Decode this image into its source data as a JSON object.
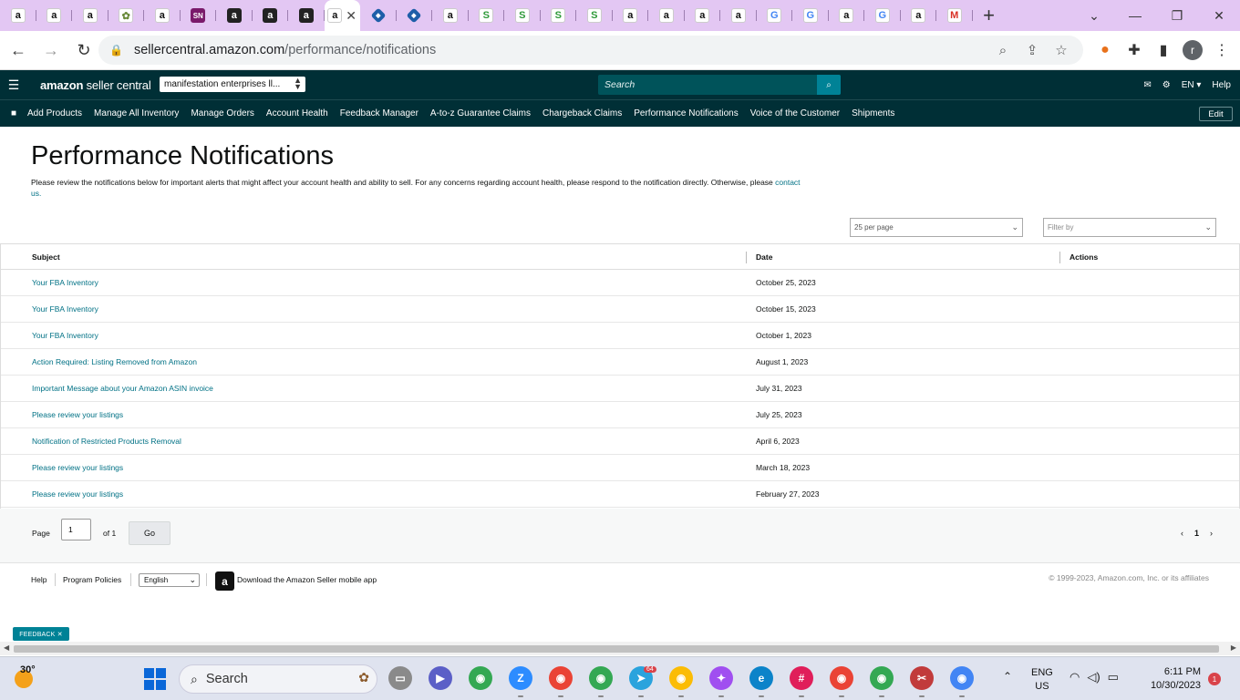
{
  "browser": {
    "tabs": [
      {
        "icon": "amazon-icon",
        "glyph": "a"
      },
      {
        "icon": "amazon-icon",
        "glyph": "a"
      },
      {
        "icon": "amazon-icon",
        "glyph": "a"
      },
      {
        "icon": "plant-icon",
        "glyph": "✿"
      },
      {
        "icon": "amazon-icon",
        "glyph": "a"
      },
      {
        "icon": "sn-icon",
        "glyph": "SN"
      },
      {
        "icon": "amazon-dark-icon",
        "glyph": "a"
      },
      {
        "icon": "amazon-dark-icon",
        "glyph": "a"
      },
      {
        "icon": "amazon-dark-icon",
        "glyph": "a"
      },
      {
        "icon": "amazon-icon",
        "glyph": "a",
        "active": true
      },
      {
        "icon": "diamond-icon",
        "glyph": "◆"
      },
      {
        "icon": "diamond-icon",
        "glyph": "◆"
      },
      {
        "icon": "amazon-icon",
        "glyph": "a"
      },
      {
        "icon": "green-s-icon",
        "glyph": "S"
      },
      {
        "icon": "green-s-icon",
        "glyph": "S"
      },
      {
        "icon": "green-s-icon",
        "glyph": "S"
      },
      {
        "icon": "green-s-icon",
        "glyph": "S"
      },
      {
        "icon": "amazon-icon",
        "glyph": "a"
      },
      {
        "icon": "amazon-icon",
        "glyph": "a"
      },
      {
        "icon": "amazon-icon",
        "glyph": "a"
      },
      {
        "icon": "amazon-icon",
        "glyph": "a"
      },
      {
        "icon": "google-icon",
        "glyph": "G"
      },
      {
        "icon": "google-icon",
        "glyph": "G"
      },
      {
        "icon": "amazon-icon",
        "glyph": "a"
      },
      {
        "icon": "google-icon",
        "glyph": "G"
      },
      {
        "icon": "amazon-icon",
        "glyph": "a"
      },
      {
        "icon": "gmail-icon",
        "glyph": "M"
      }
    ],
    "url_domain": "sellercentral.amazon.com",
    "url_path": "/performance/notifications"
  },
  "header": {
    "logo_bold": "amazon",
    "logo_text": " seller central",
    "account": "manifestation enterprises ll...",
    "search_placeholder": "Search",
    "lang": "EN ▾",
    "help": "Help"
  },
  "nav": {
    "items": [
      "Add Products",
      "Manage All Inventory",
      "Manage Orders",
      "Account Health",
      "Feedback Manager",
      "A-to-z Guarantee Claims",
      "Chargeback Claims",
      "Performance Notifications",
      "Voice of the Customer",
      "Shipments"
    ],
    "edit": "Edit"
  },
  "page": {
    "title": "Performance Notifications",
    "intro": "Please review the notifications below for important alerts that might affect your account health and ability to sell. For any concerns regarding account health, please respond to the notification directly. Otherwise, please ",
    "intro_link": "contact us.",
    "per_page": "25 per page",
    "filter_placeholder": "Filter by"
  },
  "table": {
    "headers": {
      "subject": "Subject",
      "date": "Date",
      "actions": "Actions"
    },
    "rows": [
      {
        "subject": "Your FBA Inventory",
        "date": "October 25, 2023"
      },
      {
        "subject": "Your FBA Inventory",
        "date": "October 15, 2023"
      },
      {
        "subject": "Your FBA Inventory",
        "date": "October 1, 2023"
      },
      {
        "subject": "Action Required: Listing Removed from Amazon",
        "date": "August 1, 2023"
      },
      {
        "subject": "Important Message about your Amazon ASIN invoice",
        "date": "July 31, 2023"
      },
      {
        "subject": "Please review your listings",
        "date": "July 25, 2023"
      },
      {
        "subject": "Notification of Restricted Products Removal",
        "date": "April 6, 2023"
      },
      {
        "subject": "Please review your listings",
        "date": "March 18, 2023"
      },
      {
        "subject": "Please review your listings",
        "date": "February 27, 2023"
      }
    ]
  },
  "pager": {
    "page_label": "Page",
    "page_value": "1",
    "of_label": "of 1",
    "go": "Go",
    "prev": "‹",
    "current": "1",
    "next": "›"
  },
  "footer": {
    "help": "Help",
    "program_policies": "Program Policies",
    "language": "English",
    "download_app": "Download the Amazon Seller mobile app",
    "copyright": "© 1999-2023, Amazon.com, Inc. or its affiliates",
    "feedback": "FEEDBACK ✕"
  },
  "taskbar": {
    "temp": "30°",
    "search": "Search",
    "ime_line1": "ENG",
    "ime_line2": "US",
    "time": "6:11 PM",
    "date": "10/30/2023",
    "notif_count": "1",
    "apps": [
      {
        "name": "file-explorer-icon",
        "color": "#8a8a8a",
        "glyph": "▭"
      },
      {
        "name": "meet-icon",
        "color": "#5b5fc7",
        "glyph": "▶"
      },
      {
        "name": "chrome-icon",
        "color": "#34a853",
        "glyph": "◉"
      },
      {
        "name": "zoom-icon",
        "color": "#2d8cff",
        "glyph": "Z"
      },
      {
        "name": "chrome-icon",
        "color": "#ea4335",
        "glyph": "◉"
      },
      {
        "name": "chrome-icon",
        "color": "#34a853",
        "glyph": "◉"
      },
      {
        "name": "telegram-icon",
        "color": "#2aa3dd",
        "glyph": "➤",
        "badge": "64"
      },
      {
        "name": "chrome-icon",
        "color": "#fbbc04",
        "glyph": "◉"
      },
      {
        "name": "messenger-icon",
        "color": "#a04ff0",
        "glyph": "✦"
      },
      {
        "name": "edge-icon",
        "color": "#0c83c9",
        "glyph": "e"
      },
      {
        "name": "slack-icon",
        "color": "#e01e5a",
        "glyph": "#"
      },
      {
        "name": "chrome-icon",
        "color": "#ea4335",
        "glyph": "◉"
      },
      {
        "name": "chrome-icon",
        "color": "#34a853",
        "glyph": "◉"
      },
      {
        "name": "snipping-icon",
        "color": "#c13b3b",
        "glyph": "✂"
      },
      {
        "name": "chrome-icon",
        "color": "#4285f4",
        "glyph": "◉"
      }
    ]
  },
  "colors": {
    "header_bg": "#002f36",
    "link": "#007185",
    "tab_strip": "#e3c7f3"
  }
}
